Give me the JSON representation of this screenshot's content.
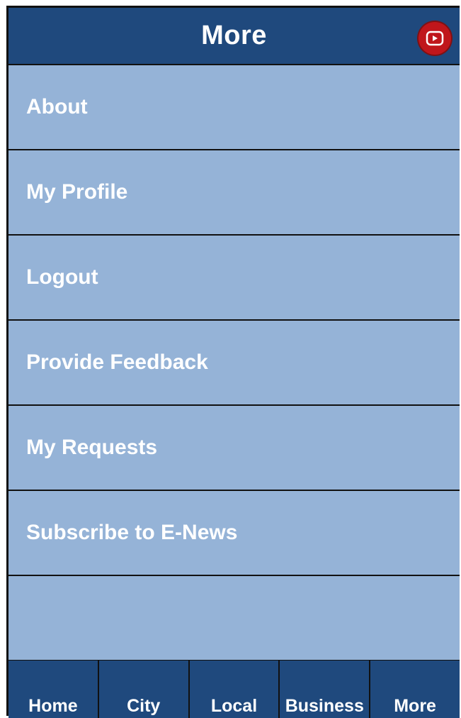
{
  "header": {
    "title": "More",
    "youtube_icon": "youtube-play-icon",
    "youtube_color": "#c0161b"
  },
  "menu": {
    "items": [
      {
        "label": "About"
      },
      {
        "label": "My Profile"
      },
      {
        "label": "Logout"
      },
      {
        "label": "Provide Feedback"
      },
      {
        "label": "My Requests"
      },
      {
        "label": "Subscribe to E-News"
      }
    ]
  },
  "tabbar": {
    "tabs": [
      {
        "label": "Home"
      },
      {
        "label": "City"
      },
      {
        "label": "Local"
      },
      {
        "label": "Business"
      },
      {
        "label": "More"
      }
    ]
  },
  "colors": {
    "header_bg": "#1f497d",
    "list_bg": "#95b3d7",
    "text": "#ffffff",
    "border": "#111111"
  }
}
